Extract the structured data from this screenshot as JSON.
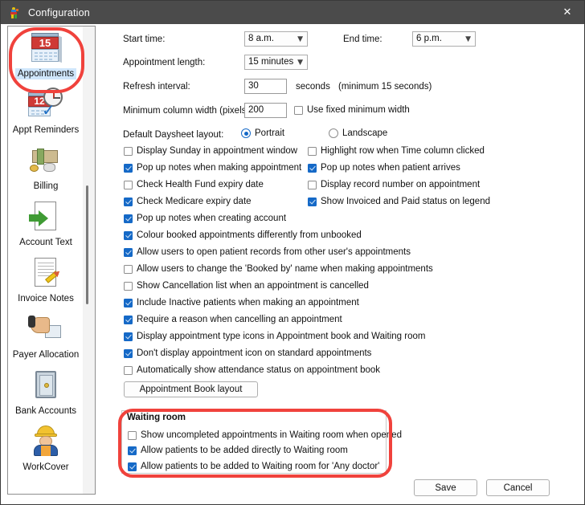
{
  "window": {
    "title": "Configuration",
    "close_label": "✕",
    "app_icon": "parrot-icon"
  },
  "sidebar": {
    "items": [
      {
        "label": "Appointments",
        "icon": "calendar-icon",
        "selected": true
      },
      {
        "label": "Appt Reminders",
        "icon": "calendar-clock-icon",
        "selected": false
      },
      {
        "label": "Billing",
        "icon": "money-icon",
        "selected": false
      },
      {
        "label": "Account Text",
        "icon": "document-green-arrow-icon",
        "selected": false
      },
      {
        "label": "Invoice Notes",
        "icon": "document-pencil-icon",
        "selected": false
      },
      {
        "label": "Payer Allocation",
        "icon": "hand-payment-icon",
        "selected": false
      },
      {
        "label": "Bank Accounts",
        "icon": "safe-icon",
        "selected": false
      },
      {
        "label": "WorkCover",
        "icon": "worker-icon",
        "selected": false
      }
    ]
  },
  "form": {
    "start_time_label": "Start time:",
    "start_time_value": "8 a.m.",
    "end_time_label": "End time:",
    "end_time_value": "6 p.m.",
    "appointment_length_label": "Appointment length:",
    "appointment_length_value": "15 minutes",
    "refresh_interval_label": "Refresh interval:",
    "refresh_interval_value": "30",
    "refresh_interval_units": "seconds",
    "refresh_interval_hint": "(minimum 15 seconds)",
    "minimum_column_width_label": "Minimum column width (pixels):",
    "minimum_column_width_value": "200",
    "use_fixed_minimum_width_label": "Use fixed minimum width",
    "use_fixed_minimum_width_checked": false,
    "daysheet_layout_label": "Default Daysheet layout:",
    "daysheet_portrait_label": "Portrait",
    "daysheet_landscape_label": "Landscape",
    "daysheet_selected": "Portrait",
    "checkboxes_left": [
      {
        "label": "Display Sunday in appointment window",
        "checked": false
      },
      {
        "label": "Pop up notes when making appointment",
        "checked": true
      },
      {
        "label": "Check Health Fund expiry date",
        "checked": false
      },
      {
        "label": "Check Medicare expiry date",
        "checked": true
      }
    ],
    "checkboxes_right": [
      {
        "label": "Highlight row when Time column clicked",
        "checked": false
      },
      {
        "label": "Pop up notes when patient arrives",
        "checked": true
      },
      {
        "label": "Display record number on appointment",
        "checked": false
      },
      {
        "label": "Show Invoiced and Paid status on legend",
        "checked": true
      }
    ],
    "checkboxes_full": [
      {
        "label": "Pop up notes when creating account",
        "checked": true
      },
      {
        "label": "Colour booked appointments differently from unbooked",
        "checked": true
      },
      {
        "label": "Allow users to open patient records from other user's appointments",
        "checked": true
      },
      {
        "label": "Allow users to change the 'Booked by' name when making appointments",
        "checked": false
      },
      {
        "label": "Show Cancellation list when an appointment is cancelled",
        "checked": false
      },
      {
        "label": "Include Inactive patients when making an appointment",
        "checked": true
      },
      {
        "label": "Require a reason when cancelling an appointment",
        "checked": true
      },
      {
        "label": "Display appointment type icons in Appointment book and Waiting room",
        "checked": true
      },
      {
        "label": "Don't display appointment icon on standard appointments",
        "checked": true
      },
      {
        "label": "Automatically show attendance status on appointment book",
        "checked": false
      }
    ],
    "appointment_book_layout_button": "Appointment Book layout"
  },
  "waiting_room": {
    "title": "Waiting room",
    "checkboxes": [
      {
        "label": "Show uncompleted appointments in Waiting room when opened",
        "checked": false
      },
      {
        "label": "Allow patients to be added directly to Waiting room",
        "checked": true
      },
      {
        "label": "Allow patients to be added to Waiting room for 'Any doctor'",
        "checked": true
      }
    ]
  },
  "footer": {
    "save_label": "Save",
    "cancel_label": "Cancel"
  },
  "annotations": {
    "accent_color": "#f0423c",
    "highlight_color": "#cfe6fb",
    "checkbox_color": "#1569c7"
  }
}
